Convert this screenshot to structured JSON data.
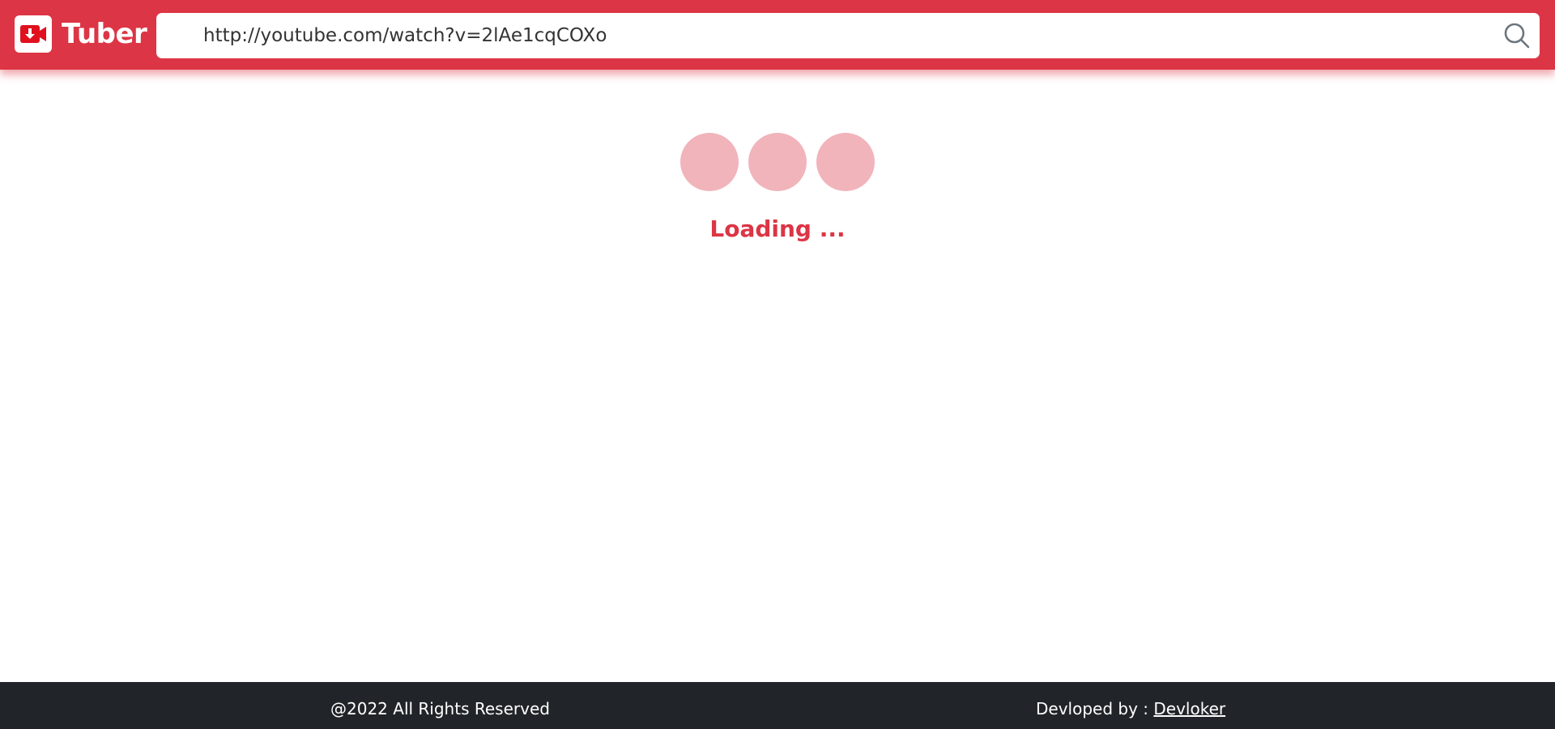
{
  "app": {
    "brand_name": "Tuber",
    "logo_icon": "video-download-icon"
  },
  "search": {
    "value": "http://youtube.com/watch?v=2lAe1cqCOXo",
    "icon": "search-icon"
  },
  "loader": {
    "text": "Loading ..."
  },
  "footer": {
    "copyright": "@2022 All Rights Reserved",
    "developed_label": "Devloped by : ",
    "developer_link": "Devloker"
  },
  "colors": {
    "primary": "#dc3545",
    "dot": "#f1b4bb",
    "footer_bg": "#212529"
  }
}
